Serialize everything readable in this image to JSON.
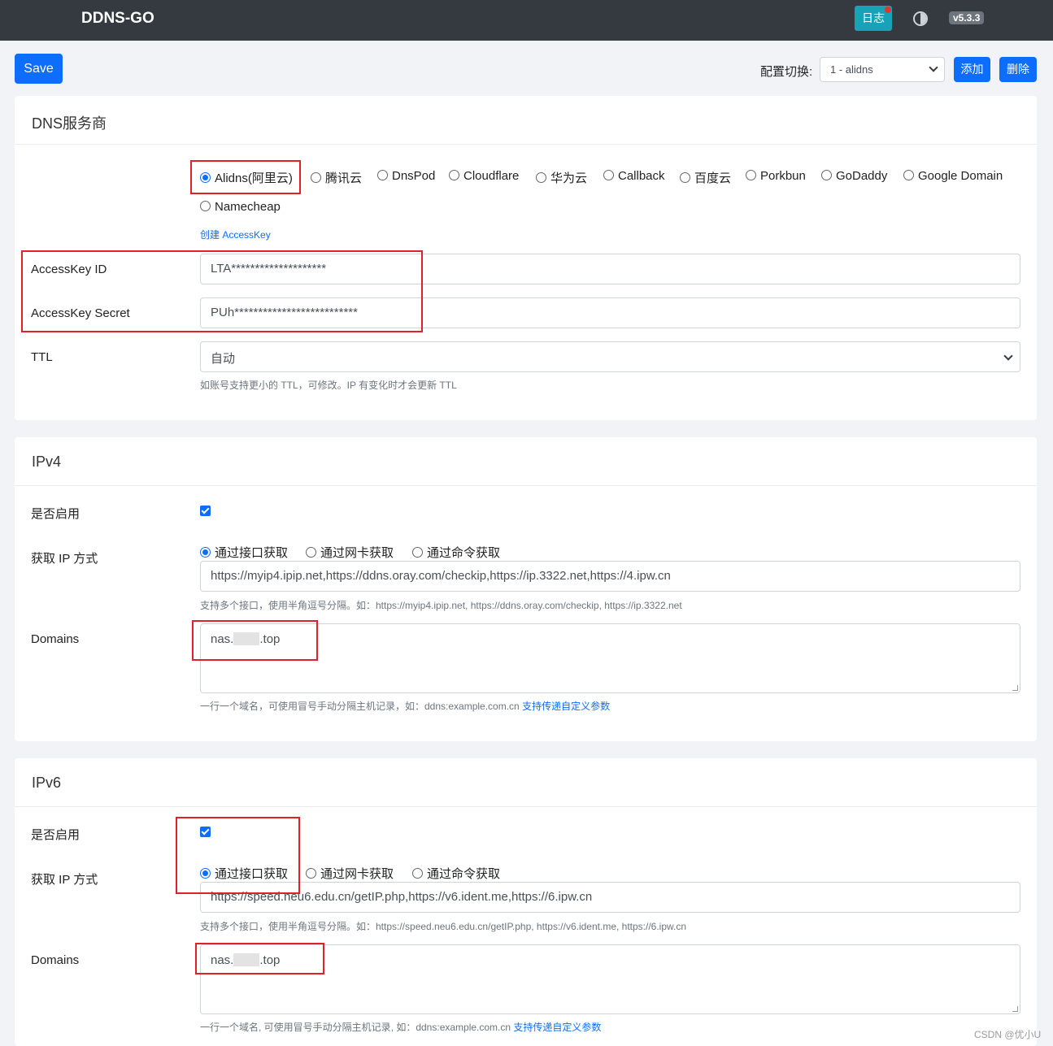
{
  "navbar": {
    "brand": "DDNS-GO",
    "log_label": "日志",
    "version": "v5.3.3",
    "theme_icon": "half-circle-icon"
  },
  "toolbar": {
    "save_label": "Save",
    "switch_label": "配置切换:",
    "switch_value": "1 - alidns",
    "add_label": "添加",
    "delete_label": "删除"
  },
  "dns": {
    "title": "DNS服务商",
    "providers": [
      "Alidns(阿里云)",
      "腾讯云",
      "DnsPod",
      "Cloudflare",
      "华为云",
      "Callback",
      "百度云",
      "Porkbun",
      "GoDaddy",
      "Google Domain",
      "Namecheap"
    ],
    "selected": "Alidns(阿里云)",
    "create_key_link": "创建 AccessKey",
    "access_key_id_label": "AccessKey ID",
    "access_key_id_value": "LTA********************",
    "access_key_secret_label": "AccessKey Secret",
    "access_key_secret_value": "PUh**************************",
    "ttl_label": "TTL",
    "ttl_value": "自动",
    "ttl_help": "如账号支持更小的 TTL，可修改。IP 有变化时才会更新 TTL"
  },
  "ipv4": {
    "title": "IPv4",
    "enable_label": "是否启用",
    "enabled": true,
    "method_label": "获取 IP 方式",
    "methods": [
      "通过接口获取",
      "通过网卡获取",
      "通过命令获取"
    ],
    "method_selected": "通过接口获取",
    "url_value": "https://myip4.ipip.net,https://ddns.oray.com/checkip,https://ip.3322.net,https://4.ipw.cn",
    "url_help": "支持多个接口，使用半角逗号分隔。如：https://myip4.ipip.net, https://ddns.oray.com/checkip, https://ip.3322.net",
    "domains_label": "Domains",
    "domain_prefix": "nas.",
    "domain_suffix": ".top",
    "domains_help": "一行一个域名，可使用冒号手动分隔主机记录，如：ddns:example.com.cn",
    "domains_help_link": "支持传递自定义参数"
  },
  "ipv6": {
    "title": "IPv6",
    "enable_label": "是否启用",
    "enabled": true,
    "method_label": "获取 IP 方式",
    "methods": [
      "通过接口获取",
      "通过网卡获取",
      "通过命令获取"
    ],
    "method_selected": "通过接口获取",
    "url_value": "https://speed.neu6.edu.cn/getIP.php,https://v6.ident.me,https://6.ipw.cn",
    "url_help": "支持多个接口，使用半角逗号分隔。如：https://speed.neu6.edu.cn/getIP.php, https://v6.ident.me, https://6.ipw.cn",
    "domains_label": "Domains",
    "domain_prefix": "nas.",
    "domain_suffix": ".top",
    "domains_help": "一行一个域名, 可使用冒号手动分隔主机记录, 如：ddns:example.com.cn",
    "domains_help_link": "支持传递自定义参数"
  },
  "watermark": "CSDN @优小U",
  "annotation_color": "#e0202a"
}
